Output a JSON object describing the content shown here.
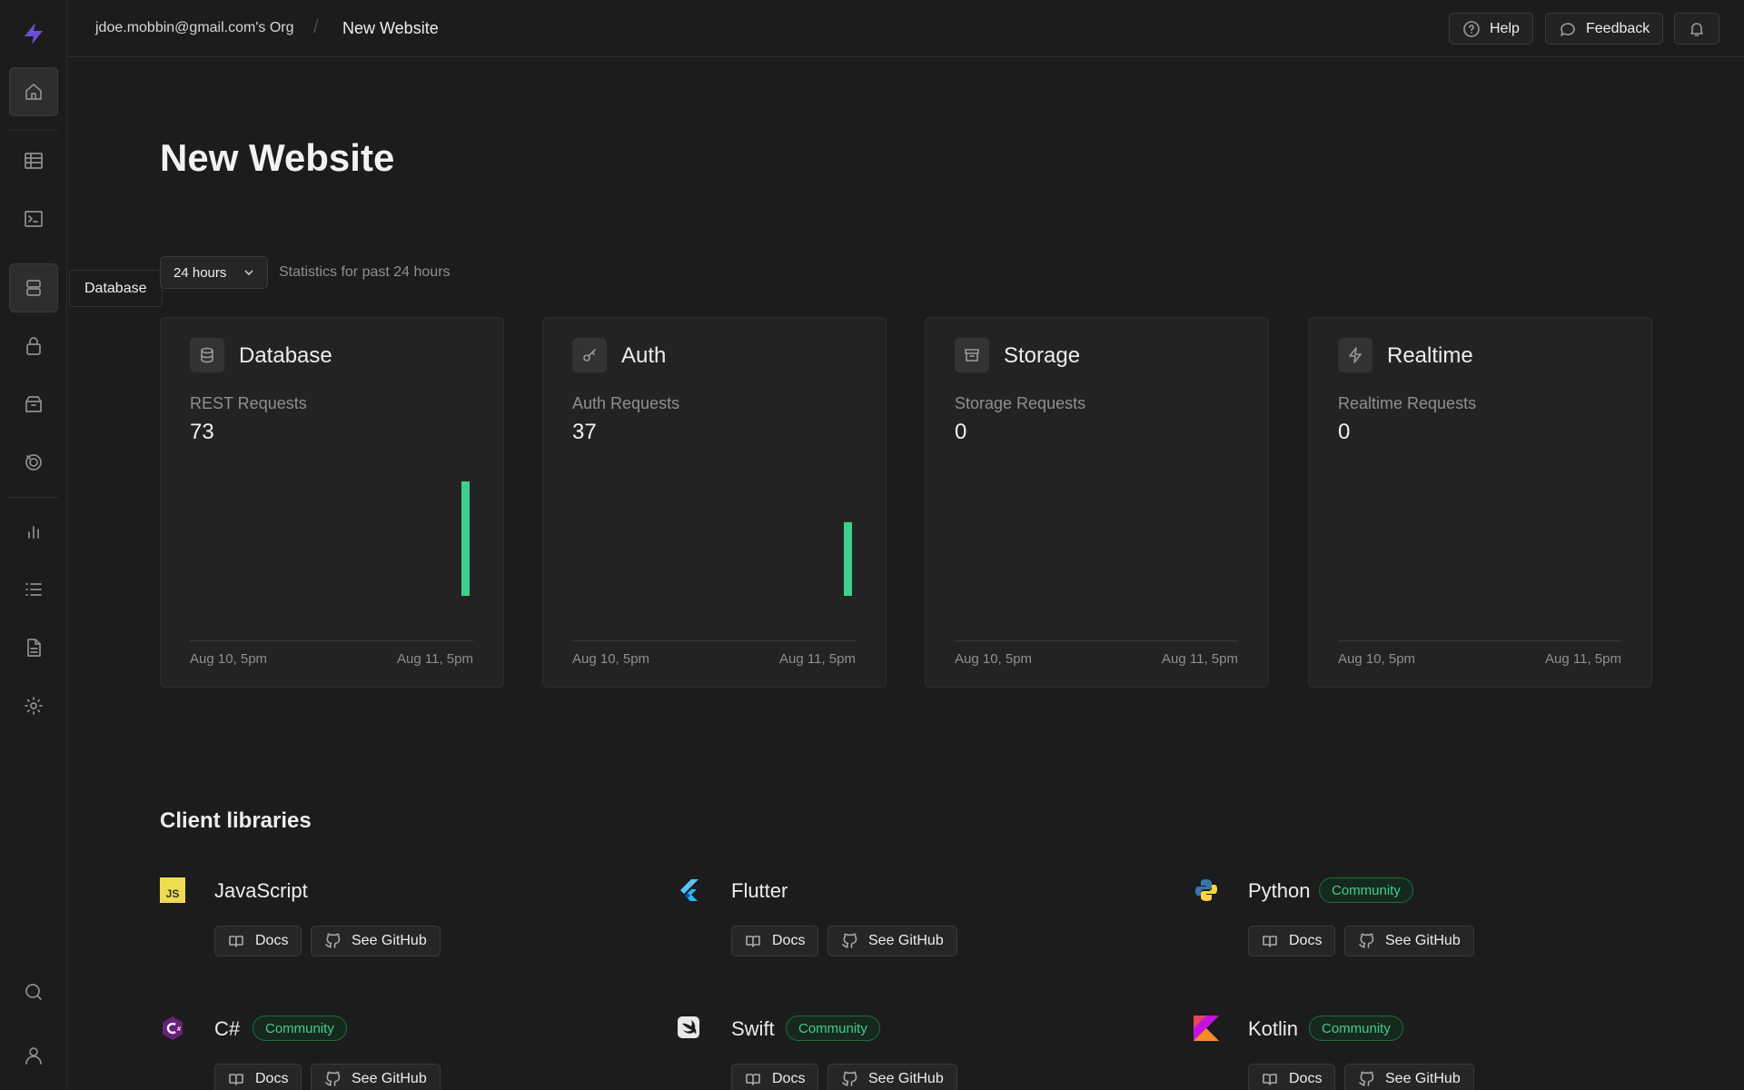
{
  "topbar": {
    "org": "jdoe.mobbin@gmail.com's Org",
    "separator": "/",
    "project": "New Website",
    "help_label": "Help",
    "feedback_label": "Feedback"
  },
  "sidebar": {
    "tooltip": "Database",
    "items": [
      {
        "name": "home",
        "icon": "home-icon"
      },
      {
        "name": "table-editor",
        "icon": "table-icon"
      },
      {
        "name": "sql-editor",
        "icon": "terminal-icon"
      },
      {
        "name": "database",
        "icon": "database-icon"
      },
      {
        "name": "auth",
        "icon": "lock-icon"
      },
      {
        "name": "storage",
        "icon": "archive-icon"
      },
      {
        "name": "realtime",
        "icon": "realtime-icon"
      },
      {
        "name": "reports",
        "icon": "bar-chart-icon"
      },
      {
        "name": "logs",
        "icon": "list-icon"
      },
      {
        "name": "api-docs",
        "icon": "document-icon"
      },
      {
        "name": "settings",
        "icon": "gear-icon"
      },
      {
        "name": "search",
        "icon": "search-icon"
      },
      {
        "name": "account",
        "icon": "user-icon"
      }
    ]
  },
  "main": {
    "title": "New Website",
    "range": "24 hours",
    "range_description": "Statistics for past 24 hours",
    "accent": "#3ecf8e"
  },
  "cards": [
    {
      "title": "Database",
      "icon": "database-icon",
      "metric": "REST Requests",
      "value": "73",
      "x_start": "Aug 10, 5pm",
      "x_end": "Aug 11, 5pm"
    },
    {
      "title": "Auth",
      "icon": "key-icon",
      "metric": "Auth Requests",
      "value": "37",
      "x_start": "Aug 10, 5pm",
      "x_end": "Aug 11, 5pm"
    },
    {
      "title": "Storage",
      "icon": "archive-icon",
      "metric": "Storage Requests",
      "value": "0",
      "x_start": "Aug 10, 5pm",
      "x_end": "Aug 11, 5pm"
    },
    {
      "title": "Realtime",
      "icon": "zap-icon",
      "metric": "Realtime Requests",
      "value": "0",
      "x_start": "Aug 10, 5pm",
      "x_end": "Aug 11, 5pm"
    }
  ],
  "client_libraries": {
    "title": "Client libraries",
    "docs_label": "Docs",
    "github_label": "See GitHub",
    "items": [
      {
        "name": "JavaScript",
        "badge": ""
      },
      {
        "name": "Flutter",
        "badge": ""
      },
      {
        "name": "Python",
        "badge": "Community"
      },
      {
        "name": "C#",
        "badge": "Community"
      },
      {
        "name": "Swift",
        "badge": "Community"
      },
      {
        "name": "Kotlin",
        "badge": "Community"
      }
    ]
  },
  "chart_data": [
    {
      "type": "bar",
      "series": [
        {
          "values": [
            0,
            0,
            0,
            0,
            0,
            0,
            0,
            0,
            0,
            0,
            0,
            0,
            0,
            0,
            0,
            0,
            0,
            0,
            0,
            0,
            0,
            0,
            0,
            73
          ]
        }
      ],
      "x_start": "Aug 10, 5pm",
      "x_end": "Aug 11, 5pm"
    },
    {
      "type": "bar",
      "series": [
        {
          "values": [
            0,
            0,
            0,
            0,
            0,
            0,
            0,
            0,
            0,
            0,
            0,
            0,
            0,
            0,
            0,
            0,
            0,
            0,
            0,
            0,
            0,
            0,
            0,
            37
          ]
        }
      ],
      "x_start": "Aug 10, 5pm",
      "x_end": "Aug 11, 5pm"
    },
    {
      "type": "bar",
      "series": [
        {
          "values": [
            0,
            0,
            0,
            0,
            0,
            0,
            0,
            0,
            0,
            0,
            0,
            0,
            0,
            0,
            0,
            0,
            0,
            0,
            0,
            0,
            0,
            0,
            0,
            0
          ]
        }
      ],
      "x_start": "Aug 10, 5pm",
      "x_end": "Aug 11, 5pm"
    },
    {
      "type": "bar",
      "series": [
        {
          "values": [
            0,
            0,
            0,
            0,
            0,
            0,
            0,
            0,
            0,
            0,
            0,
            0,
            0,
            0,
            0,
            0,
            0,
            0,
            0,
            0,
            0,
            0,
            0,
            0
          ]
        }
      ],
      "x_start": "Aug 10, 5pm",
      "x_end": "Aug 11, 5pm"
    }
  ]
}
